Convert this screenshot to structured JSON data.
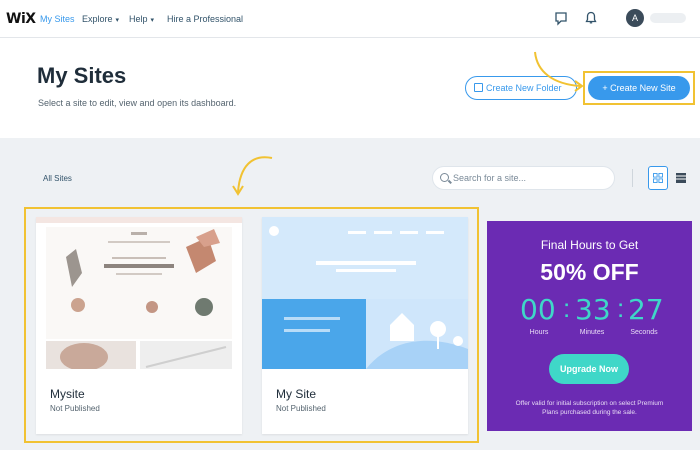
{
  "nav": {
    "logo": "WiX",
    "items": [
      {
        "label": "My Sites"
      },
      {
        "label": "Explore"
      },
      {
        "label": "Help"
      },
      {
        "label": "Hire a Professional"
      }
    ],
    "avatar_initial": "A"
  },
  "header": {
    "title": "My Sites",
    "subtitle": "Select a site to edit, view and open its dashboard.",
    "create_folder_label": "Create New Folder",
    "create_site_label": "+ Create New Site"
  },
  "toolbar": {
    "all_sites_label": "All Sites",
    "search_placeholder": "Search for a site..."
  },
  "sites": [
    {
      "name": "Mysite",
      "status": "Not Published"
    },
    {
      "name": "My Site",
      "status": "Not Published"
    }
  ],
  "promo": {
    "title": "Final Hours to Get",
    "offer": "50% OFF",
    "hours": "00",
    "minutes": "33",
    "seconds": "27",
    "hours_label": "Hours",
    "minutes_label": "Minutes",
    "seconds_label": "Seconds",
    "button_label": "Upgrade Now",
    "fine_print": "Offer valid for initial subscription on select Premium Plans purchased during the sale."
  },
  "colors": {
    "accent": "#3899ec",
    "highlight": "#f1c232",
    "promo_bg": "#6b2bb3",
    "promo_accent": "#3fd7c8"
  }
}
